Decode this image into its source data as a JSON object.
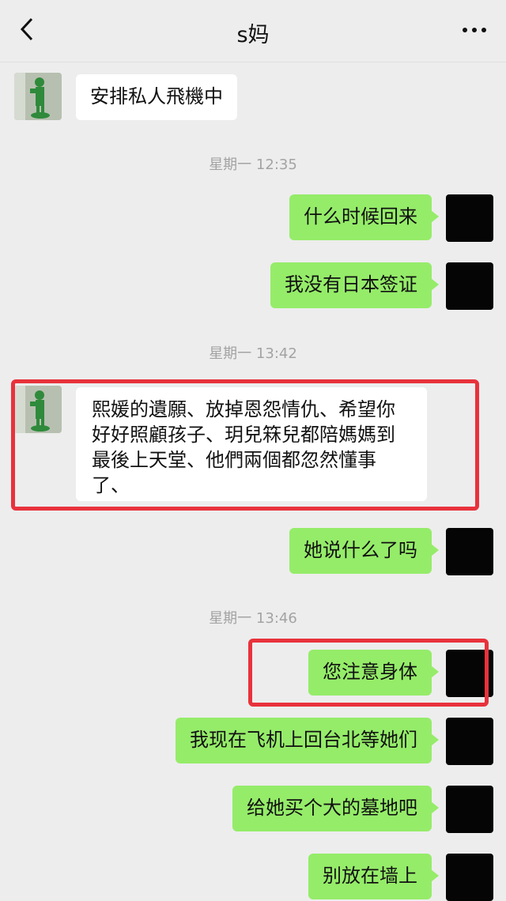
{
  "header": {
    "back_icon": "chevron-left-icon",
    "title": "s妈",
    "more_icon": "more-dots-icon"
  },
  "messages": [
    {
      "text": "安排私人飛機中"
    },
    {
      "time": "星期一 12:35"
    },
    {
      "text": "什么时候回来"
    },
    {
      "text": "我没有日本签证"
    },
    {
      "time": "星期一 13:42"
    },
    {
      "lines": [
        "熙媛的遺願、放掉恩怨情仇、希望你",
        "好好照顧孩子、玥兒箖兒都陪媽媽到",
        "最後上天堂、他們兩個都忽然懂事",
        "了、"
      ]
    },
    {
      "text": "她说什么了吗"
    },
    {
      "time": "星期一 13:46"
    },
    {
      "text": "您注意身体"
    },
    {
      "text": "我现在飞机上回台北等她们"
    },
    {
      "text": "给她买个大的墓地吧"
    },
    {
      "text": "别放在墙上"
    }
  ],
  "colors": {
    "self_bubble": "#95ec69",
    "other_bubble": "#ffffff",
    "highlight": "#e8323c",
    "background": "#ededed"
  }
}
